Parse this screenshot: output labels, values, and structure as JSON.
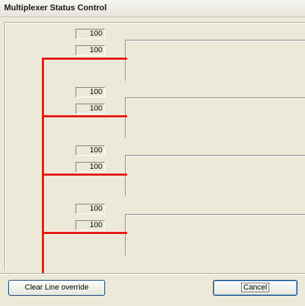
{
  "window": {
    "title": "Multiplexer Status Control"
  },
  "channels": [
    {
      "value_top": "100",
      "value_bottom": "100"
    },
    {
      "value_top": "100",
      "value_bottom": "100"
    },
    {
      "value_top": "100",
      "value_bottom": "100"
    },
    {
      "value_top": "100",
      "value_bottom": "100"
    }
  ],
  "buttons": {
    "clear_override": "Clear Line override",
    "cancel": "Cancel"
  },
  "colors": {
    "line": "#e8130d",
    "background": "#ece9d8"
  }
}
